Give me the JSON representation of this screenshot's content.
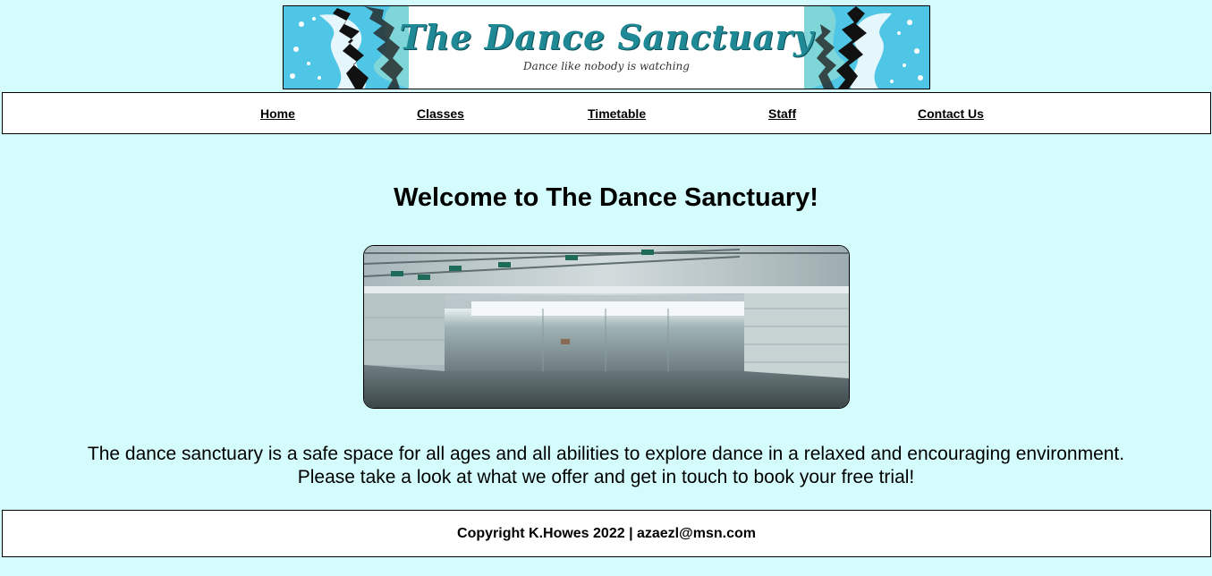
{
  "banner": {
    "title": "The Dance Sanctuary",
    "tagline": "Dance like nobody is watching"
  },
  "nav": {
    "items": [
      {
        "label": "Home"
      },
      {
        "label": "Classes"
      },
      {
        "label": "Timetable"
      },
      {
        "label": "Staff"
      },
      {
        "label": "Contact Us"
      }
    ]
  },
  "main": {
    "heading": "Welcome to The Dance Sanctuary!",
    "image_icon": "dance-studio-photo",
    "intro_line1": "The dance sanctuary is a safe space for all ages and all abilities to explore dance in a relaxed and encouraging environment.",
    "intro_line2": "Please take a look at what we offer and get in touch to book your free trial!"
  },
  "footer": {
    "text": "Copyright K.Howes 2022 | azaezl@msn.com"
  },
  "colors": {
    "page_background": "#d4fcfc",
    "banner_title": "#1f8a96"
  }
}
